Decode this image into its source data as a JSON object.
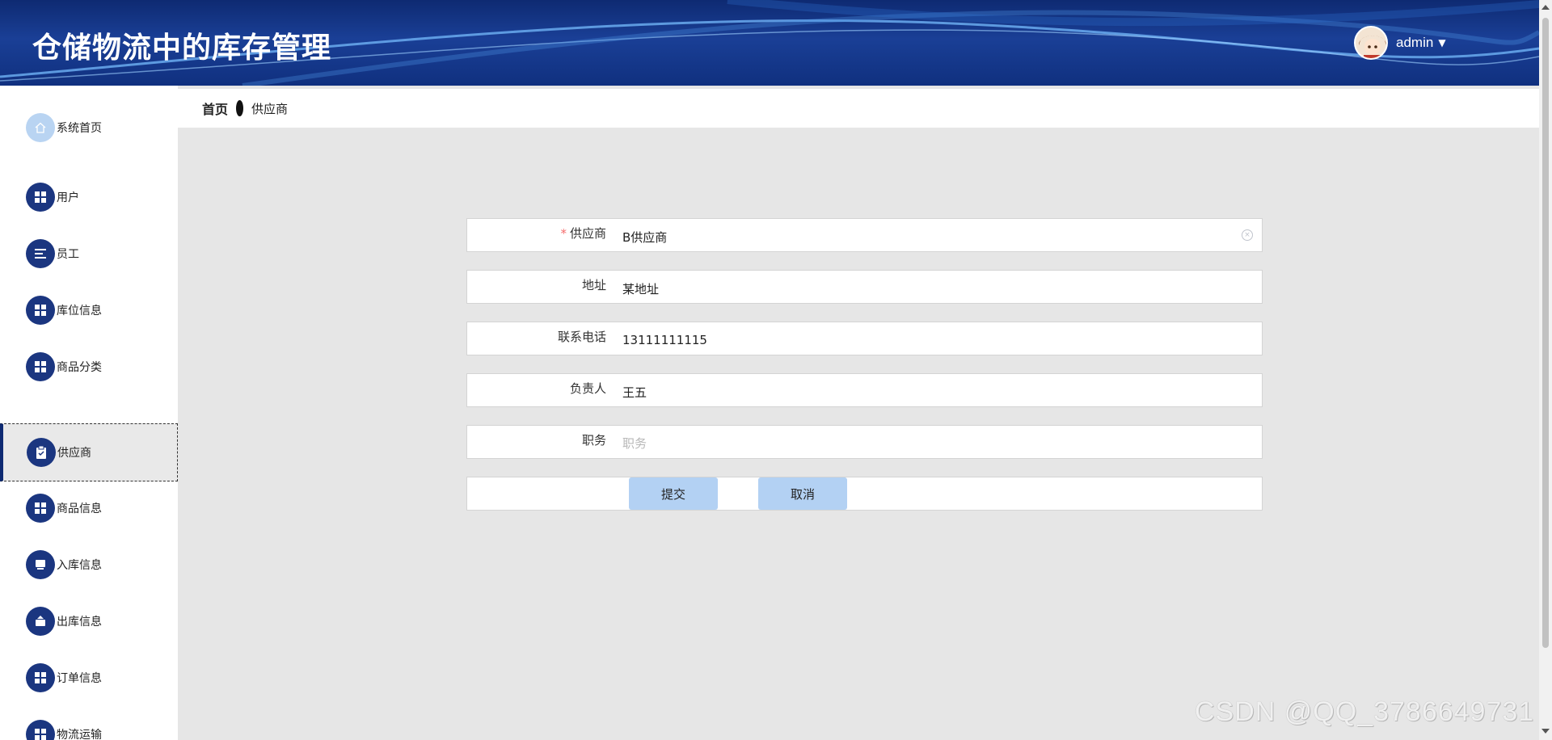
{
  "header": {
    "title": "仓储物流中的库存管理",
    "username": "admin",
    "caret": "▼"
  },
  "breadcrumb": {
    "home": "首页",
    "current": "供应商"
  },
  "sidebar": {
    "items": [
      {
        "label": "系统首页",
        "icon": "home-icon"
      },
      {
        "label": "用户",
        "icon": "grid-icon"
      },
      {
        "label": "员工",
        "icon": "list-icon"
      },
      {
        "label": "库位信息",
        "icon": "grid-icon"
      },
      {
        "label": "商品分类",
        "icon": "grid-icon"
      },
      {
        "label": "供应商",
        "icon": "clipboard-icon",
        "active": true
      },
      {
        "label": "商品信息",
        "icon": "grid-icon"
      },
      {
        "label": "入库信息",
        "icon": "inbox-icon"
      },
      {
        "label": "出库信息",
        "icon": "outbox-icon"
      },
      {
        "label": "订单信息",
        "icon": "grid-icon"
      },
      {
        "label": "物流运输",
        "icon": "grid-icon"
      }
    ]
  },
  "form": {
    "supplier": {
      "label": "供应商",
      "required_mark": "*",
      "value": "B供应商"
    },
    "address": {
      "label": "地址",
      "value": "某地址"
    },
    "phone": {
      "label": "联系电话",
      "value": "13111111115"
    },
    "manager": {
      "label": "负责人",
      "value": "王五"
    },
    "position": {
      "label": "职务",
      "value": "",
      "placeholder": "职务"
    },
    "submit_label": "提交",
    "cancel_label": "取消"
  },
  "watermark": "CSDN @QQ_3786649731",
  "colors": {
    "header_bg": "#1a3f96",
    "nav_icon_bg": "#1b3680",
    "button_bg": "#b3d1f3",
    "content_bg": "#e6e6e6"
  }
}
